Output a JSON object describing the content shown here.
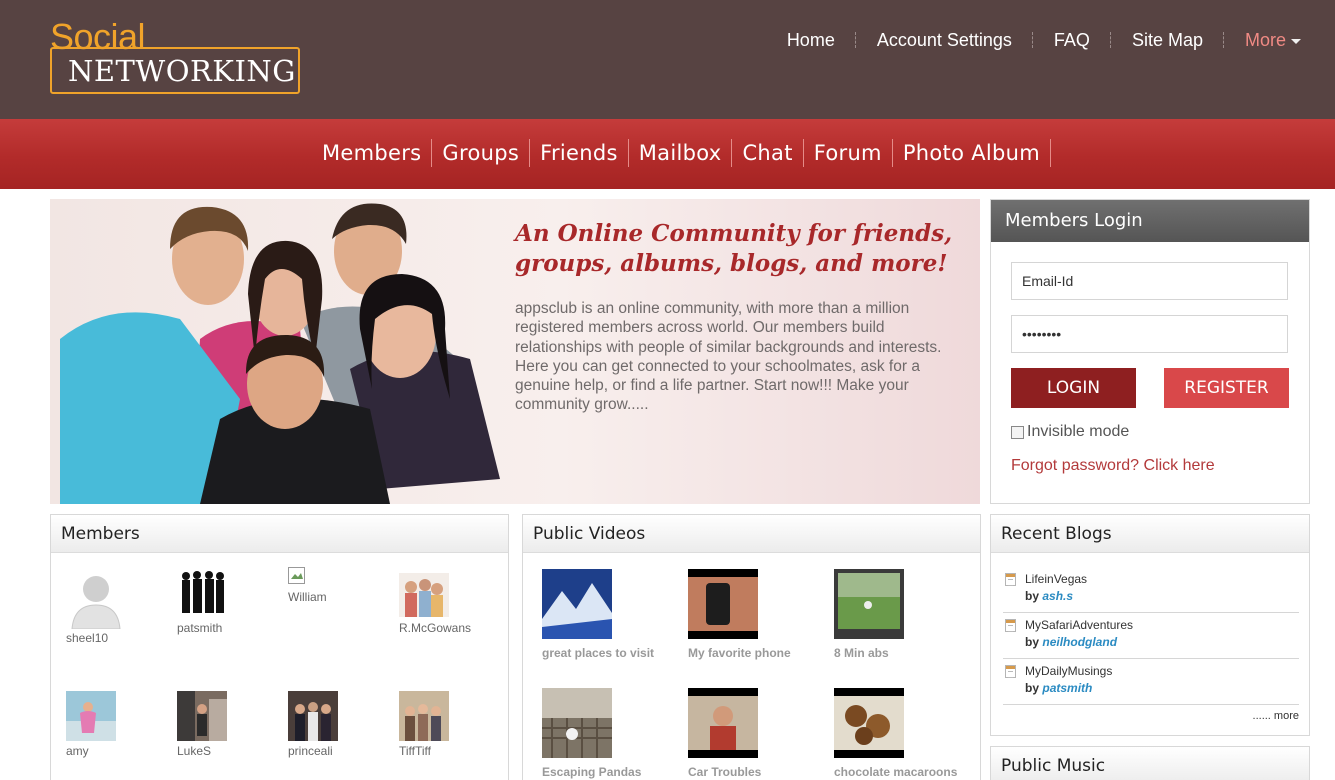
{
  "logo": {
    "top": "Social",
    "bottom": "NETWORKING"
  },
  "top_nav": {
    "items": [
      "Home",
      "Account Settings",
      "FAQ",
      "Site Map"
    ],
    "more": "More"
  },
  "main_nav": {
    "items": [
      "Members",
      "Groups",
      "Friends",
      "Mailbox",
      "Chat",
      "Forum",
      "Photo Album"
    ]
  },
  "hero": {
    "title": "An Online Community for friends, groups, albums, blogs, and more!",
    "text": "appsclub is an online community, with more than a million registered members across world. Our members build relationships with people of similar backgrounds and interests. Here you can get connected to your schoolmates, ask for a genuine help, or find a life partner. Start now!!! Make your community grow....."
  },
  "login": {
    "title": "Members Login",
    "email_value": "Email-Id",
    "password_value": "••••••••",
    "login_label": "LOGIN",
    "register_label": "REGISTER",
    "invisible_label": "Invisible mode",
    "forgot_label": "Forgot password? Click here"
  },
  "members": {
    "title": "Members",
    "items": [
      {
        "name": "sheel10",
        "icon": "default-avatar-icon"
      },
      {
        "name": "patsmith",
        "icon": "group-silhouette-icon"
      },
      {
        "name": "William",
        "icon": "broken-image-icon"
      },
      {
        "name": "R.McGowans",
        "icon": "family-photo"
      },
      {
        "name": "amy",
        "icon": "beach-photo"
      },
      {
        "name": "LukeS",
        "icon": "street-photo"
      },
      {
        "name": "princeali",
        "icon": "group-photo"
      },
      {
        "name": "TiffTiff",
        "icon": "friends-photo"
      }
    ]
  },
  "videos": {
    "title": "Public Videos",
    "items": [
      {
        "title": "great places to visit",
        "icon": "mountains-video-thumb"
      },
      {
        "title": "My favorite phone",
        "icon": "phone-video-thumb"
      },
      {
        "title": "8 Min abs",
        "icon": "park-video-thumb"
      },
      {
        "title": "Escaping Pandas",
        "icon": "panda-video-thumb"
      },
      {
        "title": "Car Troubles",
        "icon": "person-video-thumb"
      },
      {
        "title": "chocolate macaroons",
        "icon": "food-video-thumb"
      }
    ]
  },
  "blogs": {
    "title": "Recent Blogs",
    "by_label": "by",
    "items": [
      {
        "title": "LifeinVegas",
        "author": "ash.s"
      },
      {
        "title": "MySafariAdventures",
        "author": "neilhodgland"
      },
      {
        "title": "MyDailyMusings",
        "author": "patsmith"
      }
    ],
    "more_label": "...... more"
  },
  "music": {
    "title": "Public Music"
  },
  "colors": {
    "header": "#574342",
    "accent_red": "#b22b2a",
    "logo_orange": "#f0a32a",
    "link_blue": "#2b8bc2"
  }
}
